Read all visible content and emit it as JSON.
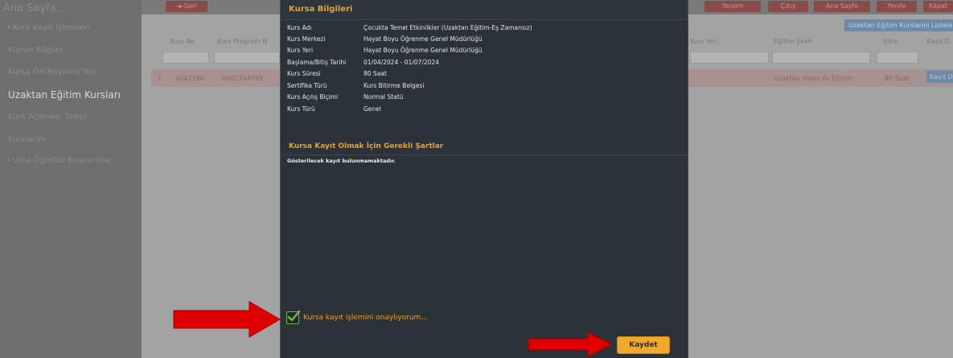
{
  "sidebar": {
    "title": "Ana Sayfa...",
    "items": [
      {
        "label": "Kurs Kayıt İşlemleri",
        "bullet": true
      },
      {
        "label": "Kişisel Bilgiler",
        "bullet": false
      },
      {
        "label": "Kursa Ön Başvuru Yap",
        "bullet": false
      },
      {
        "label": "Uzaktan Eğitim Kursları",
        "bullet": false,
        "active": true
      },
      {
        "label": "Kurs Açılması Talebi",
        "bullet": false
      },
      {
        "label": "Kurslarım",
        "bullet": false
      },
      {
        "label": "Usta Öğretici Başvurusu",
        "bullet": true
      }
    ]
  },
  "topbar": {
    "left_button": "◄ Geri",
    "right_buttons": [
      "Yardım",
      "Çıkış",
      "Ana Sayfa",
      "Yenile",
      "Kapat"
    ]
  },
  "table": {
    "filter_button": "Uzaktan Eğitim Kurslarını Listele",
    "headers": [
      "Kurs No",
      "Kurs Program N",
      "Kurs Yeri",
      "Eğitim Şekli",
      "Süre",
      "Kayıt D"
    ],
    "row": {
      "index": "1",
      "kurs_no": "4042190",
      "program_no": "6665334799",
      "egitim_sekli": "Uzaktan Video ile Eğitim",
      "sure": "80 Saat",
      "action": "Kayıt D"
    }
  },
  "modal": {
    "title": "Kursa Bilgileri",
    "info": [
      {
        "key": "Kurs Adı",
        "value": "Çocukta Temel Etkinlikler (Uzaktan Eğitim-Eş Zamansız)"
      },
      {
        "key": "Kurs Merkezi",
        "value": "Hayat Boyu Öğrenme Genel Müdürlüğü"
      },
      {
        "key": "Kurs Yeri",
        "value": "Hayat Boyu Öğrenme Genel Müdürlüğü"
      },
      {
        "key": "Başlama/Bitiş Tarihi",
        "value": "01/04/2024 - 01/07/2024"
      },
      {
        "key": "Kurs Süresi",
        "value": "80 Saat"
      },
      {
        "key": "Sertifika Türü",
        "value": "Kurs Bitirme Belgesi"
      },
      {
        "key": "Kurs Açılış Biçimi",
        "value": "Normal Statü"
      },
      {
        "key": "Kurs Türü",
        "value": "Genel"
      }
    ],
    "requirements_title": "Kursa Kayıt Olmak İçin Gerekli Şartlar",
    "no_record": "Gösterilecek kayıt bulunmamaktadır.",
    "approve_label": "Kursa kayıt işlemini onaylıyorum...",
    "approve_checked": true,
    "save_label": "Kaydet"
  },
  "colors": {
    "accent": "#e9a028",
    "modal_bg": "#2b3339",
    "check": "#79b33b",
    "arrow": "#e00000"
  }
}
